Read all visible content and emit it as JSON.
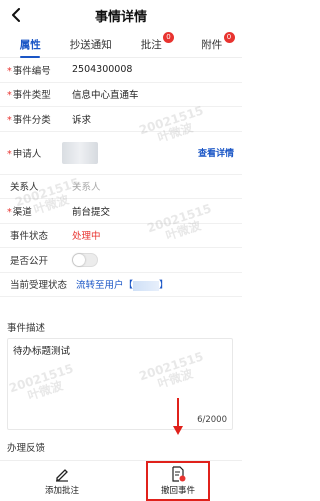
{
  "header": {
    "title": "事情详情"
  },
  "tabs": [
    {
      "label": "属性",
      "active": true,
      "badge": ""
    },
    {
      "label": "抄送通知",
      "active": false,
      "badge": ""
    },
    {
      "label": "批注",
      "active": false,
      "badge": "0"
    },
    {
      "label": "附件",
      "active": false,
      "badge": "0"
    }
  ],
  "fields": {
    "event_no": {
      "label": "事件编号",
      "value": "2504300008"
    },
    "event_type": {
      "label": "事件类型",
      "value": "信息中心直通车"
    },
    "event_category": {
      "label": "事件分类",
      "value": "诉求"
    },
    "applicant": {
      "label": "申请人",
      "link": "查看详情"
    },
    "contact": {
      "label": "关系人",
      "placeholder": "关系人"
    },
    "channel": {
      "label": "渠道",
      "value": "前台提交"
    },
    "status": {
      "label": "事件状态",
      "value": "处理中"
    },
    "public": {
      "label": "是否公开",
      "on": false
    },
    "handler": {
      "label": "当前受理状态",
      "value": "流转至用户【",
      "value_end": "】"
    }
  },
  "description": {
    "section_label": "事件描述",
    "text": "待办标题测试",
    "count": "6/2000"
  },
  "feedback": {
    "section_label": "办理反馈"
  },
  "watermark": {
    "line1": "20021515",
    "line2": "叶微波"
  },
  "actions": {
    "add_comment": "添加批注",
    "recall": "撤回事件"
  },
  "colors": {
    "accent": "#1a56c6",
    "alert": "#e8332f",
    "highlight": "#e0211b"
  }
}
